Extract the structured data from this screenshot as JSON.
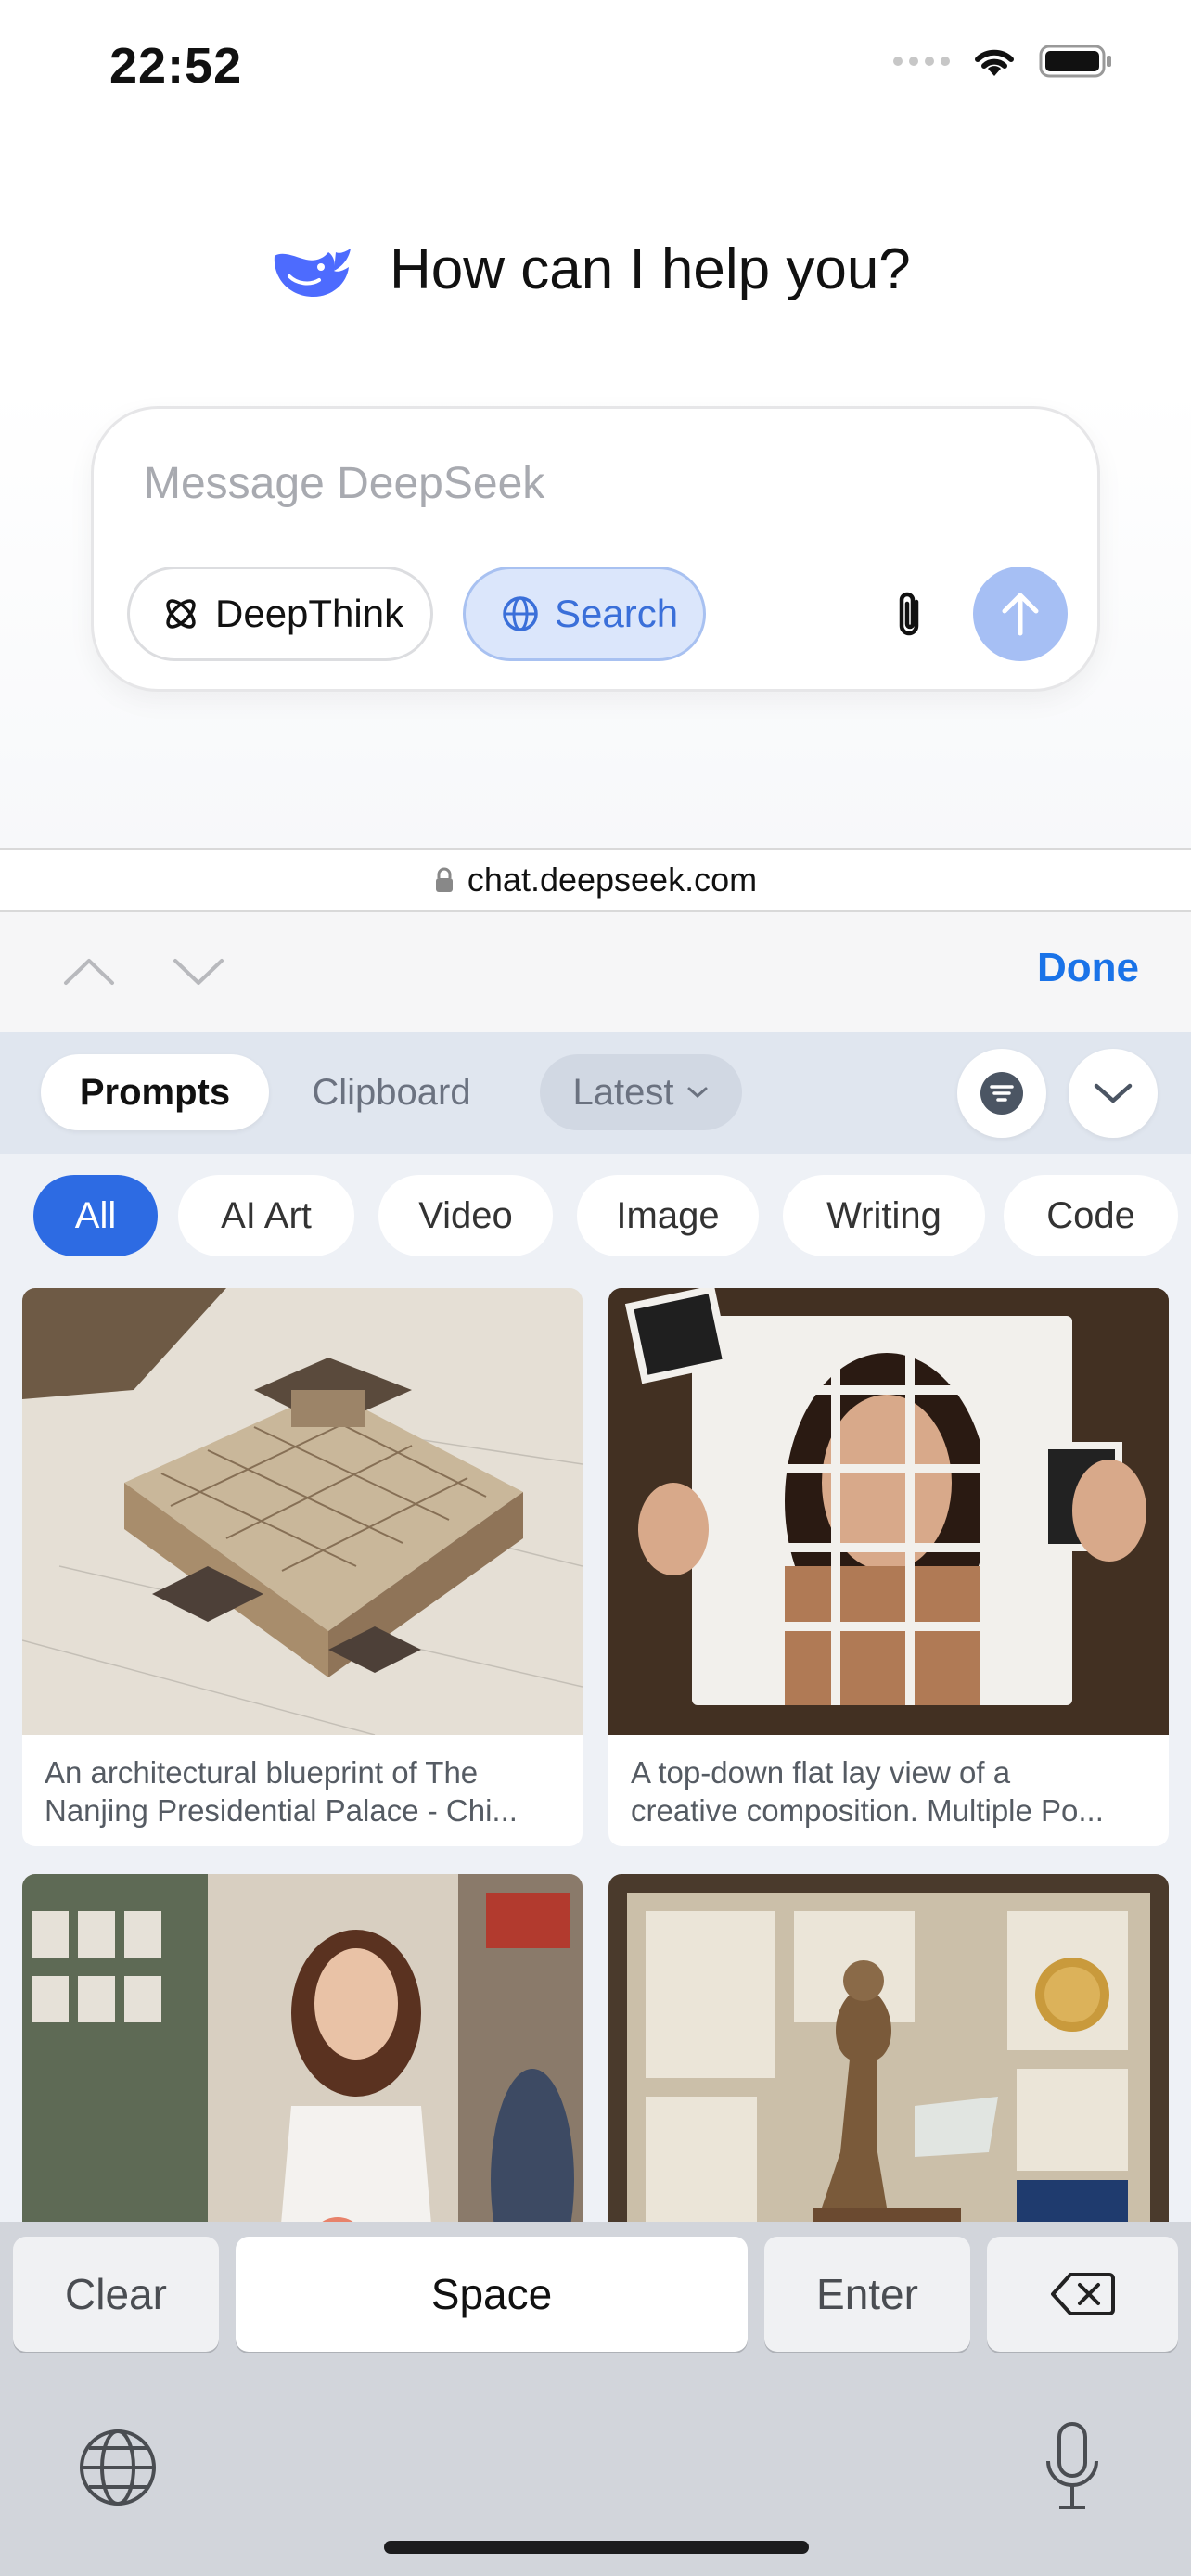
{
  "status_bar": {
    "time": "22:52"
  },
  "hero": {
    "title": "How can I help you?",
    "logo_icon": "deepseek-whale-logo"
  },
  "composer": {
    "placeholder": "Message DeepSeek",
    "deepthink_label": "DeepThink",
    "search_label": "Search",
    "search_active": true,
    "accent_color": "#3a6fd9"
  },
  "url_bar": {
    "url": "chat.deepseek.com"
  },
  "accessory": {
    "done_label": "Done"
  },
  "panel": {
    "tabs": [
      {
        "label": "Prompts",
        "active": true
      },
      {
        "label": "Clipboard",
        "active": false
      }
    ],
    "sort_label": "Latest",
    "categories": [
      {
        "label": "All",
        "active": true
      },
      {
        "label": "AI Art",
        "active": false
      },
      {
        "label": "Video",
        "active": false
      },
      {
        "label": "Image",
        "active": false
      },
      {
        "label": "Writing",
        "active": false
      },
      {
        "label": "Code",
        "active": false
      }
    ],
    "cards": [
      {
        "caption_line1": "An architectural blueprint of The",
        "caption_line2": "Nanjing Presidential Palace - Chi..."
      },
      {
        "caption_line1": "A top-down flat lay view of a",
        "caption_line2": "creative composition. Multiple Po..."
      },
      {
        "caption_line1": "",
        "caption_line2": ""
      },
      {
        "caption_line1": "",
        "caption_line2": ""
      }
    ]
  },
  "keyboard": {
    "clear_label": "Clear",
    "space_label": "Space",
    "enter_label": "Enter"
  }
}
